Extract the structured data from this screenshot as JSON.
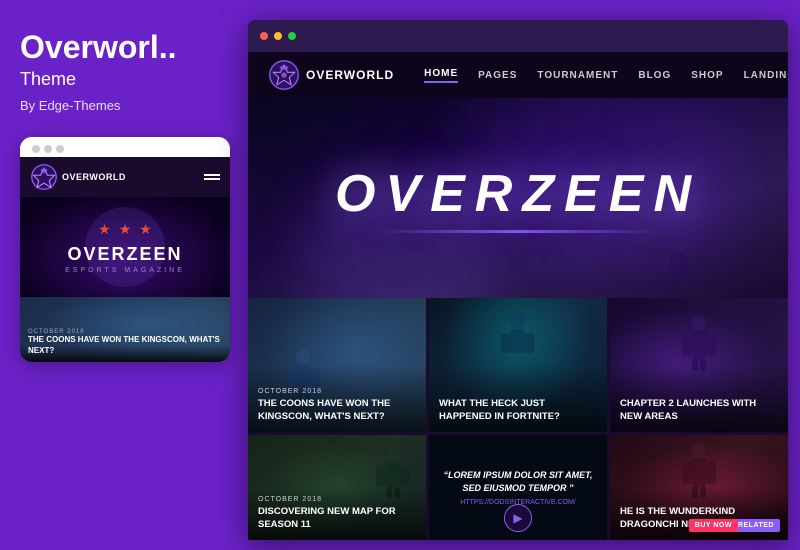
{
  "left": {
    "title": "Overworl..",
    "subtitle": "Theme",
    "author": "By Edge-Themes",
    "mobile": {
      "dots": [
        "dot1",
        "dot2",
        "dot3"
      ],
      "logo_text": "OVERWORLD",
      "hero_title": "OVERZEEN",
      "hero_sub": "ESPORTS MAGAZINE",
      "article_date": "OCTOBER 2018",
      "article_title": "THE COONS HAVE WON THE KINGSCON, WHAT'S NEXT?"
    }
  },
  "browser": {
    "dots": [
      "dot-red",
      "dot-yellow",
      "dot-green"
    ],
    "nav": {
      "logo_text": "OVERWORLD",
      "links": [
        "HOME",
        "PAGES",
        "TOURNAMENT",
        "BLOG",
        "SHOP",
        "LANDING"
      ],
      "active_link": "HOME"
    },
    "hero": {
      "title": "OVERZEEN"
    },
    "articles_row1": [
      {
        "date": "OCTOBER 2018",
        "title": "THE COONS HAVE WON THE KINGSCON, WHAT'S NEXT?"
      },
      {
        "date": "",
        "title": "WHAT THE HECK JUST HAPPENED IN FORTNITE?"
      },
      {
        "date": "",
        "title": "CHAPTER 2 LAUNCHES WITH NEW AREAS"
      }
    ],
    "articles_row2": [
      {
        "date": "OCTOBER 2018",
        "title": "DISCOVERING NEW MAP FOR SEASON 11"
      },
      {
        "quote": "“LOREM IPSUM DOLOR SIT AMET, SED EIUSMOD TEMPOR ”",
        "url": "HTTPS://DODSINTERACTIVE.COM/"
      },
      {
        "date": "",
        "title": "HE IS THE WUNDERKIND DRAGONCHI NEEDED"
      }
    ],
    "badges": {
      "related": "RELATED",
      "buy_now": "BUY NOW"
    }
  }
}
